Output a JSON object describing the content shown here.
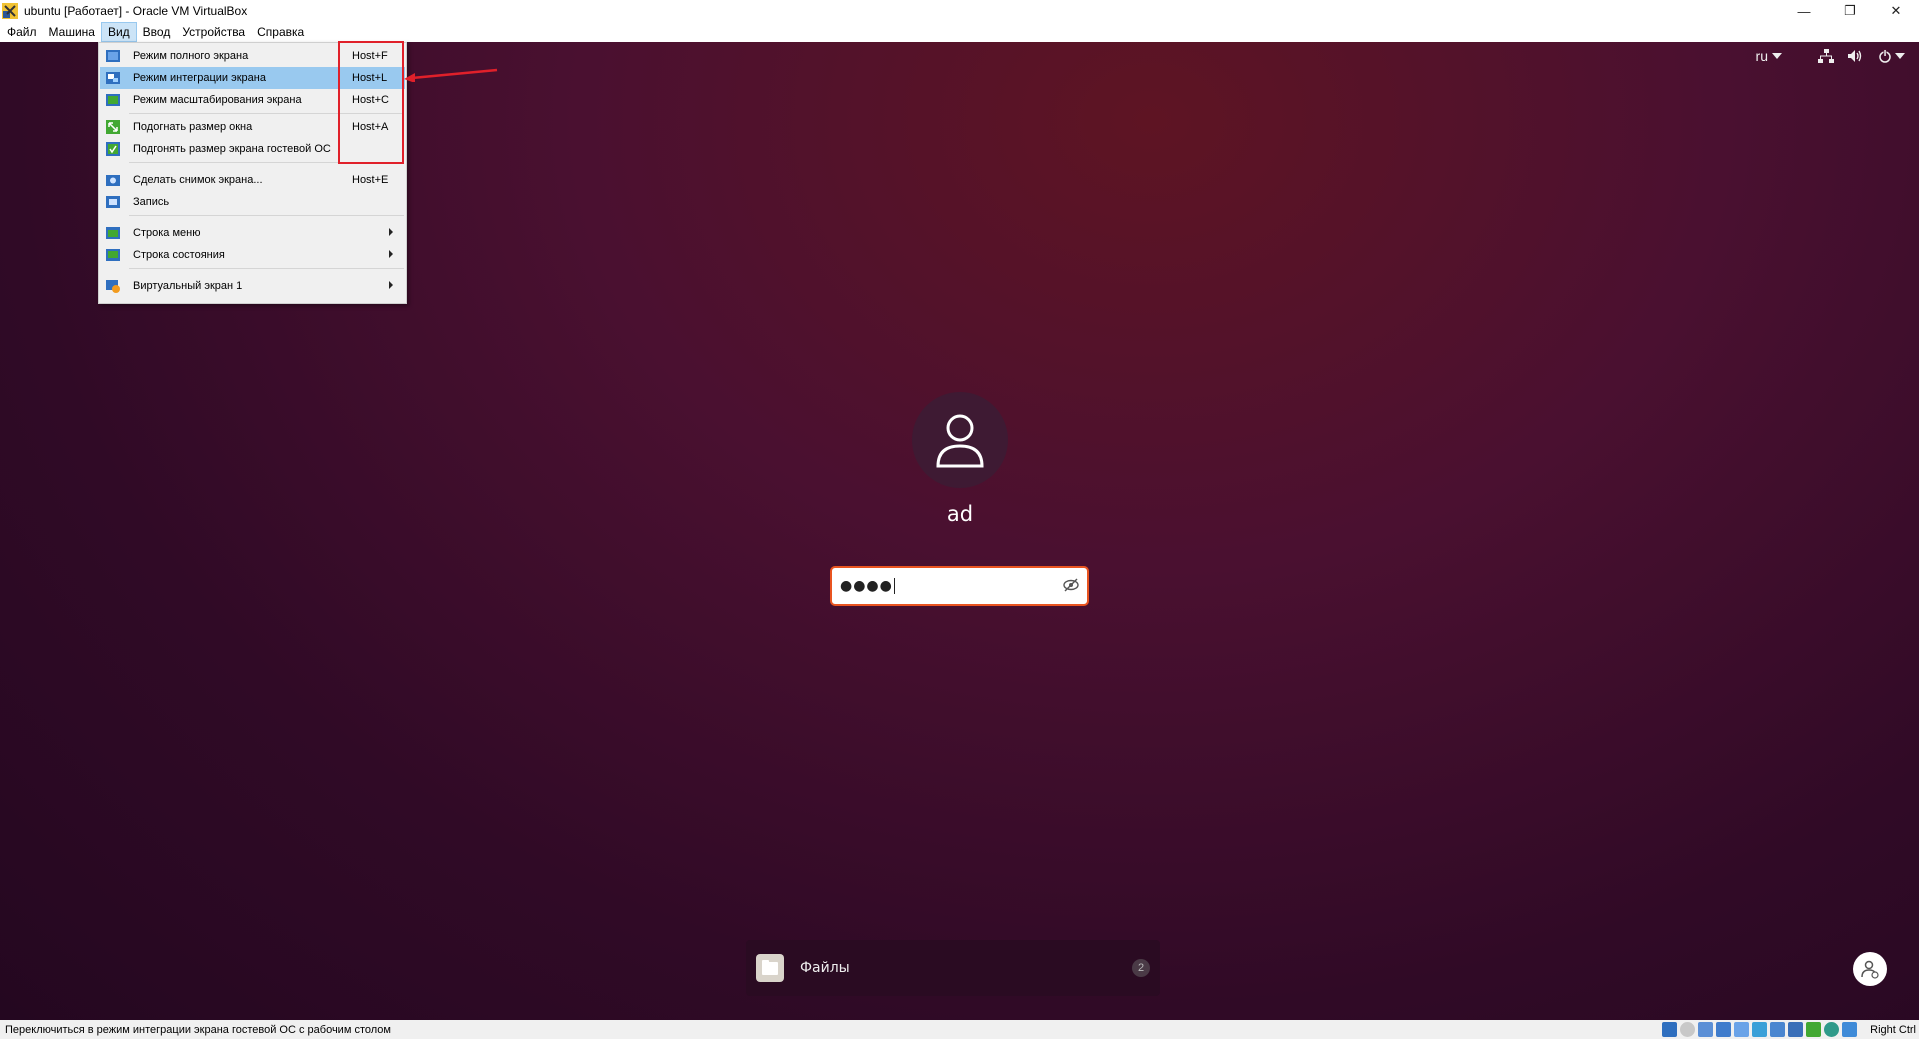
{
  "window": {
    "title": "ubuntu [Работает] - Oracle VM VirtualBox",
    "controls": [
      "—",
      "❐",
      "✕"
    ]
  },
  "menubar": {
    "items": [
      "Файл",
      "Машина",
      "Вид",
      "Ввод",
      "Устройства",
      "Справка"
    ],
    "active_index": 2
  },
  "view_menu": {
    "items": [
      {
        "label": "Режим полного экрана",
        "shortcut": "Host+F",
        "icon": "fullscreen-icon",
        "highlighted": false
      },
      {
        "label": "Режим интеграции экрана",
        "shortcut": "Host+L",
        "icon": "seamless-mode-icon",
        "highlighted": true
      },
      {
        "label": "Режим масштабирования экрана",
        "shortcut": "Host+C",
        "icon": "scale-mode-icon",
        "highlighted": false
      },
      {
        "label": "Подогнать размер окна",
        "shortcut": "Host+A",
        "icon": "adjust-window-icon",
        "highlighted": false
      },
      {
        "label": "Подгонять размер экрана гостевой ОС",
        "shortcut": "",
        "icon": "auto-resize-guest-icon",
        "highlighted": false
      },
      {
        "label": "Сделать снимок экрана...",
        "shortcut": "Host+E",
        "icon": "screenshot-icon",
        "highlighted": false
      },
      {
        "label": "Запись",
        "shortcut": "",
        "icon": "recording-icon",
        "highlighted": false
      },
      {
        "label": "Строка меню",
        "shortcut": "",
        "icon": "menu-bar-icon",
        "submenu": true
      },
      {
        "label": "Строка состояния",
        "shortcut": "",
        "icon": "status-bar-icon",
        "submenu": true
      },
      {
        "label": "Виртуальный экран 1",
        "shortcut": "",
        "icon": "virtual-screen-icon",
        "submenu": true
      }
    ]
  },
  "guest": {
    "top_panel": {
      "language": "ru",
      "icons": [
        "network-icon",
        "volume-icon",
        "power-icon"
      ]
    },
    "login": {
      "username": "ad",
      "password_mask": "●●●●"
    },
    "notification": {
      "app_name": "Файлы",
      "count": "2"
    }
  },
  "statusbar": {
    "text": "Переключиться в режим интеграции экрана гостевой ОС с рабочим столом",
    "host_key": "Right Ctrl"
  },
  "colors": {
    "menu_highlight": "#99c9ef",
    "annotation_red": "#e0202a",
    "ubuntu_orange": "#e95420"
  }
}
